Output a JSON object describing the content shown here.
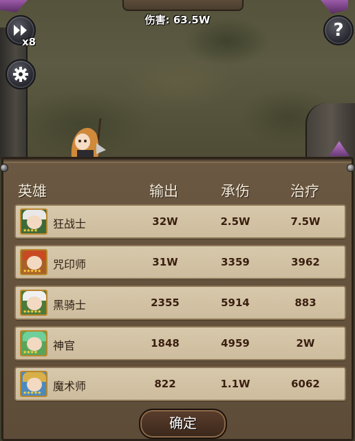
{
  "hud": {
    "damage_label": "伤害: 63.5W",
    "speed_multiplier": "x8",
    "help_symbol": "?",
    "speed_icon": "fast-forward-icon",
    "settings_icon": "gear-icon"
  },
  "table": {
    "headers": {
      "hero": "英雄",
      "output": "输出",
      "tank": "承伤",
      "heal": "治疗"
    },
    "rows": [
      {
        "name": "狂战士",
        "output": "32W",
        "tank": "2.5W",
        "heal": "7.5W",
        "portrait_bg": "#3d6a3a",
        "hair": "#e8e8e8",
        "stars": 4
      },
      {
        "name": "咒印师",
        "output": "31W",
        "tank": "3359",
        "heal": "3962",
        "portrait_bg": "#a86028",
        "hair": "#c94a22",
        "stars": 5
      },
      {
        "name": "黑骑士",
        "output": "2355",
        "tank": "5914",
        "heal": "883",
        "portrait_bg": "#4b7a3a",
        "hair": "#f0f0f0",
        "stars": 5
      },
      {
        "name": "神官",
        "output": "1848",
        "tank": "4959",
        "heal": "2W",
        "portrait_bg": "#5aa45a",
        "hair": "#6fcf9a",
        "stars": 4
      },
      {
        "name": "魔术师",
        "output": "822",
        "tank": "1.1W",
        "heal": "6062",
        "portrait_bg": "#4a8ac0",
        "hair": "#d8b04a",
        "stars": 5
      }
    ]
  },
  "confirm_label": "确定"
}
